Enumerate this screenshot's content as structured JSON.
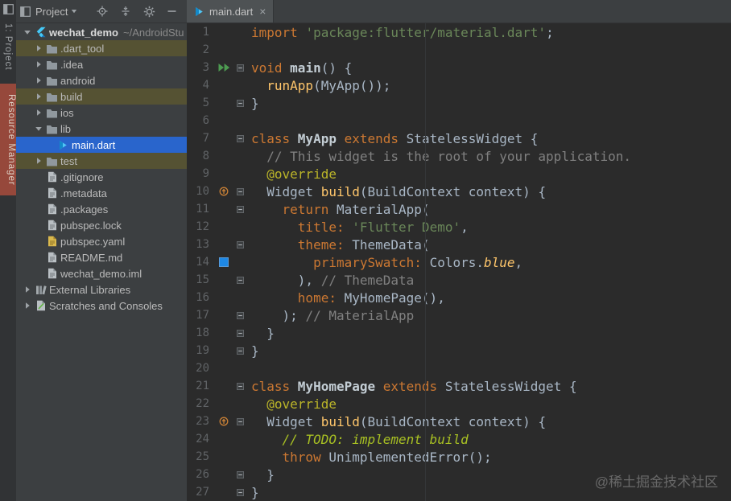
{
  "activity_bar": {
    "top_tab": "1: Project",
    "resource_tab": "Resource Manager"
  },
  "toolbar": {
    "panel_title": "Project",
    "icons": [
      "tool-window-icon",
      "caret-down-icon",
      "locate-file-icon",
      "collapse-all-icon",
      "settings-gear-icon",
      "hide-panel-icon"
    ]
  },
  "editor_tabs": [
    {
      "label": "main.dart",
      "icon": "dart-file-icon",
      "close": "×"
    }
  ],
  "project_tree": {
    "items": [
      {
        "label": "wechat_demo",
        "suffix": "~/AndroidStu",
        "indent": 0,
        "chevron": "down",
        "icon": "flutter",
        "style": "root"
      },
      {
        "label": ".dart_tool",
        "indent": 1,
        "chevron": "right",
        "icon": "folder",
        "style": "excluded"
      },
      {
        "label": ".idea",
        "indent": 1,
        "chevron": "right",
        "icon": "folder",
        "style": "normal"
      },
      {
        "label": "android",
        "indent": 1,
        "chevron": "right",
        "icon": "folder",
        "style": "normal"
      },
      {
        "label": "build",
        "indent": 1,
        "chevron": "right",
        "icon": "folder",
        "style": "excluded"
      },
      {
        "label": "ios",
        "indent": 1,
        "chevron": "right",
        "icon": "folder",
        "style": "normal"
      },
      {
        "label": "lib",
        "indent": 1,
        "chevron": "down",
        "icon": "folder",
        "style": "normal"
      },
      {
        "label": "main.dart",
        "indent": 2,
        "chevron": "none",
        "icon": "dart",
        "style": "selected"
      },
      {
        "label": "test",
        "indent": 1,
        "chevron": "right",
        "icon": "folder",
        "style": "excluded"
      },
      {
        "label": ".gitignore",
        "indent": 1,
        "chevron": "none",
        "icon": "file",
        "style": "normal"
      },
      {
        "label": ".metadata",
        "indent": 1,
        "chevron": "none",
        "icon": "file",
        "style": "normal"
      },
      {
        "label": ".packages",
        "indent": 1,
        "chevron": "none",
        "icon": "file",
        "style": "normal"
      },
      {
        "label": "pubspec.lock",
        "indent": 1,
        "chevron": "none",
        "icon": "file",
        "style": "normal"
      },
      {
        "label": "pubspec.yaml",
        "indent": 1,
        "chevron": "none",
        "icon": "yaml",
        "style": "normal"
      },
      {
        "label": "README.md",
        "indent": 1,
        "chevron": "none",
        "icon": "file",
        "style": "normal"
      },
      {
        "label": "wechat_demo.iml",
        "indent": 1,
        "chevron": "none",
        "icon": "file",
        "style": "normal"
      },
      {
        "label": "External Libraries",
        "indent": 0,
        "chevron": "right",
        "icon": "libraries",
        "style": "normal"
      },
      {
        "label": "Scratches and Consoles",
        "indent": 0,
        "chevron": "right",
        "icon": "scratches",
        "style": "normal"
      }
    ]
  },
  "editor": {
    "lines": [
      {
        "num": 1,
        "gutter": "none",
        "fold": false,
        "tokens": [
          [
            "kw",
            "import "
          ],
          [
            "str",
            "'package:flutter/material.dart'"
          ],
          [
            "pln",
            ";"
          ]
        ]
      },
      {
        "num": 2,
        "gutter": "none",
        "fold": false,
        "tokens": []
      },
      {
        "num": 3,
        "gutter": "run",
        "fold": true,
        "tokens": [
          [
            "kw",
            "void "
          ],
          [
            "dcl",
            "main"
          ],
          [
            "pln",
            "() {"
          ]
        ]
      },
      {
        "num": 4,
        "gutter": "none",
        "fold": false,
        "tokens": [
          [
            "pln",
            "  "
          ],
          [
            "fn",
            "runApp"
          ],
          [
            "pln",
            "("
          ],
          [
            "typ",
            "MyApp"
          ],
          [
            "pln",
            "());"
          ]
        ]
      },
      {
        "num": 5,
        "gutter": "none",
        "fold": true,
        "tokens": [
          [
            "pln",
            "}"
          ]
        ]
      },
      {
        "num": 6,
        "gutter": "none",
        "fold": false,
        "tokens": []
      },
      {
        "num": 7,
        "gutter": "none",
        "fold": true,
        "tokens": [
          [
            "kw",
            "class "
          ],
          [
            "dcl",
            "MyApp"
          ],
          [
            "kw",
            " extends "
          ],
          [
            "typ",
            "StatelessWidget"
          ],
          [
            "pln",
            " {"
          ]
        ]
      },
      {
        "num": 8,
        "gutter": "none",
        "fold": false,
        "tokens": [
          [
            "cmt",
            "  // This widget is the root of your application."
          ]
        ]
      },
      {
        "num": 9,
        "gutter": "none",
        "fold": false,
        "tokens": [
          [
            "ann",
            "  @override"
          ]
        ]
      },
      {
        "num": 10,
        "gutter": "override",
        "fold": true,
        "tokens": [
          [
            "typ",
            "  Widget "
          ],
          [
            "fn",
            "build"
          ],
          [
            "pln",
            "("
          ],
          [
            "typ",
            "BuildContext"
          ],
          [
            "pln",
            " context) {"
          ]
        ]
      },
      {
        "num": 11,
        "gutter": "none",
        "fold": true,
        "tokens": [
          [
            "pln",
            "    "
          ],
          [
            "kw",
            "return "
          ],
          [
            "typ",
            "MaterialApp"
          ],
          [
            "pln",
            "("
          ]
        ]
      },
      {
        "num": 12,
        "gutter": "none",
        "fold": false,
        "tokens": [
          [
            "pln",
            "      "
          ],
          [
            "arg",
            "title: "
          ],
          [
            "str",
            "'Flutter Demo'"
          ],
          [
            "pln",
            ","
          ]
        ]
      },
      {
        "num": 13,
        "gutter": "none",
        "fold": true,
        "tokens": [
          [
            "pln",
            "      "
          ],
          [
            "arg",
            "theme: "
          ],
          [
            "typ",
            "ThemeData"
          ],
          [
            "pln",
            "("
          ]
        ]
      },
      {
        "num": 14,
        "gutter": "colorswatch",
        "fold": false,
        "tokens": [
          [
            "pln",
            "        "
          ],
          [
            "arg",
            "primarySwatch: "
          ],
          [
            "typ",
            "Colors"
          ],
          [
            "pln",
            "."
          ],
          [
            "fld",
            "blue"
          ],
          [
            "pln",
            ","
          ]
        ]
      },
      {
        "num": 15,
        "gutter": "none",
        "fold": true,
        "tokens": [
          [
            "pln",
            "      ), "
          ],
          [
            "cmt",
            "// ThemeData"
          ]
        ]
      },
      {
        "num": 16,
        "gutter": "none",
        "fold": false,
        "tokens": [
          [
            "pln",
            "      "
          ],
          [
            "arg",
            "home: "
          ],
          [
            "typ",
            "MyHomePage"
          ],
          [
            "pln",
            "(),"
          ]
        ]
      },
      {
        "num": 17,
        "gutter": "none",
        "fold": true,
        "tokens": [
          [
            "pln",
            "    ); "
          ],
          [
            "cmt",
            "// MaterialApp"
          ]
        ]
      },
      {
        "num": 18,
        "gutter": "none",
        "fold": true,
        "tokens": [
          [
            "pln",
            "  }"
          ]
        ]
      },
      {
        "num": 19,
        "gutter": "none",
        "fold": true,
        "tokens": [
          [
            "pln",
            "}"
          ]
        ]
      },
      {
        "num": 20,
        "gutter": "none",
        "fold": false,
        "tokens": []
      },
      {
        "num": 21,
        "gutter": "none",
        "fold": true,
        "tokens": [
          [
            "kw",
            "class "
          ],
          [
            "dcl",
            "MyHomePage"
          ],
          [
            "kw",
            " extends "
          ],
          [
            "typ",
            "StatelessWidget"
          ],
          [
            "pln",
            " {"
          ]
        ]
      },
      {
        "num": 22,
        "gutter": "none",
        "fold": false,
        "tokens": [
          [
            "ann",
            "  @override"
          ]
        ]
      },
      {
        "num": 23,
        "gutter": "override",
        "fold": true,
        "tokens": [
          [
            "typ",
            "  Widget "
          ],
          [
            "fn",
            "build"
          ],
          [
            "pln",
            "("
          ],
          [
            "typ",
            "BuildContext"
          ],
          [
            "pln",
            " context) {"
          ]
        ]
      },
      {
        "num": 24,
        "gutter": "none",
        "fold": false,
        "tokens": [
          [
            "todo",
            "    // TODO: implement build"
          ]
        ]
      },
      {
        "num": 25,
        "gutter": "none",
        "fold": false,
        "tokens": [
          [
            "pln",
            "    "
          ],
          [
            "kw",
            "throw "
          ],
          [
            "typ",
            "UnimplementedError"
          ],
          [
            "pln",
            "();"
          ]
        ]
      },
      {
        "num": 26,
        "gutter": "none",
        "fold": true,
        "tokens": [
          [
            "pln",
            "  }"
          ]
        ]
      },
      {
        "num": 27,
        "gutter": "none",
        "fold": true,
        "tokens": [
          [
            "pln",
            "}"
          ]
        ]
      }
    ]
  },
  "watermark": "@稀土掘金技术社区",
  "colors": {
    "editor_bg": "#2b2b2b",
    "panel_bg": "#3c3f41",
    "activity_bar_bg": "#313335",
    "selection_blue": "#2965cc",
    "excluded_olive": "#555233",
    "resource_tab_red": "#96483b",
    "keyword_orange": "#cc7832",
    "string_green": "#6a8759",
    "comment_gray": "#808080",
    "todo_green": "#a8c023",
    "annotation_yellow": "#bbb529",
    "function_yellow": "#ffc66b",
    "default_text": "#a9b7c6",
    "line_number_gray": "#606366",
    "run_icon_green": "#4d9b51",
    "color_swatch_blue": "#1e88e5"
  }
}
